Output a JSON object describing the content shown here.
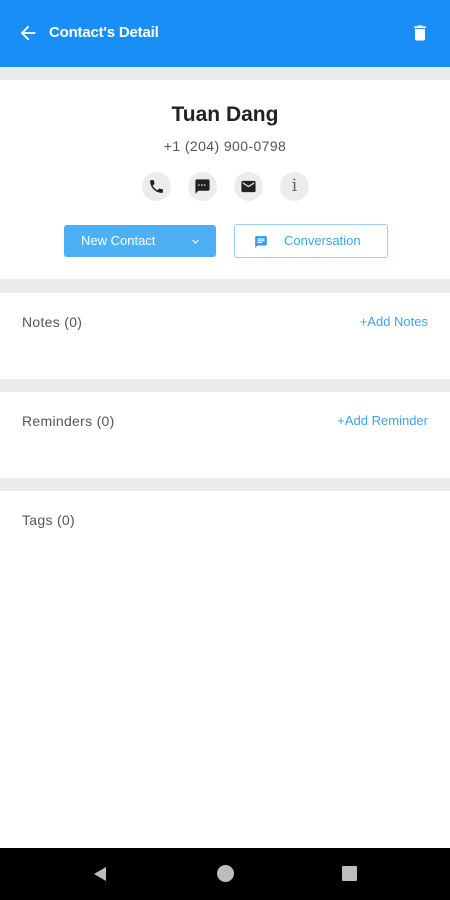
{
  "appbar": {
    "title": "Contact's Detail",
    "back_icon": "arrow-left-icon",
    "delete_icon": "trash-icon",
    "color": "#1a8ef7"
  },
  "contact": {
    "name": "Tuan Dang",
    "phone": "+1 (204) 900-0798"
  },
  "actions": {
    "call_icon": "phone-icon",
    "message_icon": "message-icon",
    "email_icon": "mail-icon",
    "info_icon": "info-icon",
    "info_glyph": "i"
  },
  "buttons": {
    "new_contact": "New Contact",
    "conversation": "Conversation"
  },
  "notes": {
    "label": "Notes (0)",
    "add": "+Add Notes"
  },
  "reminders": {
    "label": "Reminders (0)",
    "add": "+Add Reminder"
  },
  "tags": {
    "label": "Tags (0)"
  },
  "system_nav": {
    "back_icon": "nav-back-icon",
    "home_icon": "nav-home-icon",
    "recents_icon": "nav-recents-icon"
  }
}
